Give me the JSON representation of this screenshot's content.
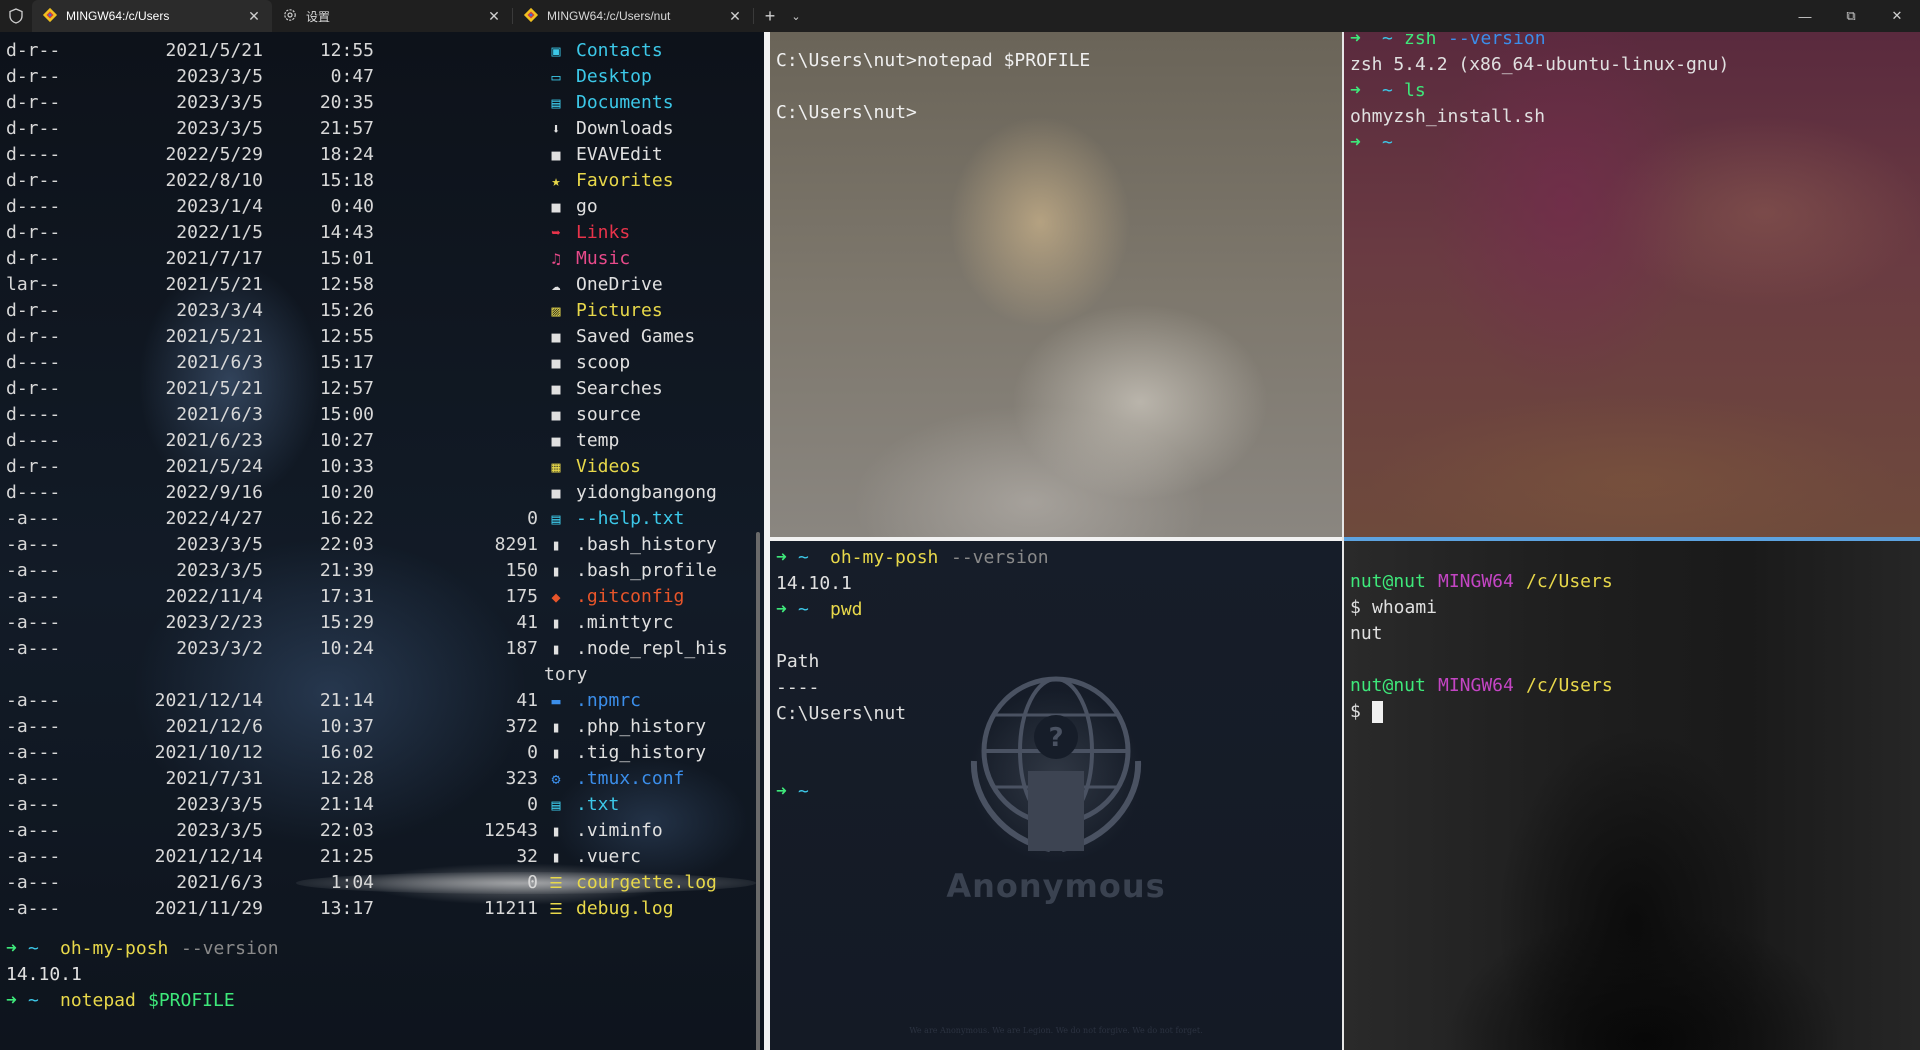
{
  "tabs": [
    {
      "title": "MINGW64:/c/Users",
      "active": true,
      "icon": "git-diamond-icon"
    },
    {
      "title": "设置",
      "active": false,
      "icon": "gear-icon"
    },
    {
      "title": "MINGW64:/c/Users/nut",
      "active": false,
      "icon": "git-diamond-icon"
    }
  ],
  "titlebar": {
    "new_tab": "+",
    "dropdown": "⌄",
    "minimize": "—",
    "maximize": "⧉",
    "close": "✕",
    "tab_close": "✕"
  },
  "colors": {
    "folder": "#e0e0e0",
    "accent_cyan": "#3cc8e8",
    "accent_yellow": "#e8d84a",
    "accent_red": "#e8334a",
    "accent_pink": "#e84a8a",
    "prompt_green": "#3ee87a"
  },
  "listing": [
    {
      "mode": "d-r--",
      "date": "2021/5/21",
      "time": "12:55",
      "size": "",
      "name": "Contacts",
      "icon": "contacts-icon",
      "color": "#3cc8e8"
    },
    {
      "mode": "d-r--",
      "date": "2023/3/5",
      "time": "0:47",
      "size": "",
      "name": "Desktop",
      "icon": "desktop-icon",
      "color": "#3cc8e8"
    },
    {
      "mode": "d-r--",
      "date": "2023/3/5",
      "time": "20:35",
      "size": "",
      "name": "Documents",
      "icon": "documents-icon",
      "color": "#3cc8e8"
    },
    {
      "mode": "d-r--",
      "date": "2023/3/5",
      "time": "21:57",
      "size": "",
      "name": "Downloads",
      "icon": "download-icon",
      "color": "#e0e0e0"
    },
    {
      "mode": "d----",
      "date": "2022/5/29",
      "time": "18:24",
      "size": "",
      "name": "EVAVEdit",
      "icon": "folder-icon",
      "color": "#e0e0e0"
    },
    {
      "mode": "d-r--",
      "date": "2022/8/10",
      "time": "15:18",
      "size": "",
      "name": "Favorites",
      "icon": "favorites-folder-icon",
      "color": "#e8d84a"
    },
    {
      "mode": "d----",
      "date": "2023/1/4",
      "time": "0:40",
      "size": "",
      "name": "go",
      "icon": "folder-icon",
      "color": "#e0e0e0"
    },
    {
      "mode": "d-r--",
      "date": "2022/1/5",
      "time": "14:43",
      "size": "",
      "name": "Links",
      "icon": "links-icon",
      "color": "#e8334a"
    },
    {
      "mode": "d-r--",
      "date": "2021/7/17",
      "time": "15:01",
      "size": "",
      "name": "Music",
      "icon": "music-icon",
      "color": "#e84a8a"
    },
    {
      "mode": "lar--",
      "date": "2021/5/21",
      "time": "12:58",
      "size": "",
      "name": "OneDrive",
      "icon": "cloud-icon",
      "color": "#e0e0e0"
    },
    {
      "mode": "d-r--",
      "date": "2023/3/4",
      "time": "15:26",
      "size": "",
      "name": "Pictures",
      "icon": "pictures-icon",
      "color": "#e8d84a"
    },
    {
      "mode": "d-r--",
      "date": "2021/5/21",
      "time": "12:55",
      "size": "",
      "name": "Saved Games",
      "icon": "folder-icon",
      "color": "#e0e0e0"
    },
    {
      "mode": "d----",
      "date": "2021/6/3",
      "time": "15:17",
      "size": "",
      "name": "scoop",
      "icon": "folder-icon",
      "color": "#e0e0e0"
    },
    {
      "mode": "d-r--",
      "date": "2021/5/21",
      "time": "12:57",
      "size": "",
      "name": "Searches",
      "icon": "folder-icon",
      "color": "#e0e0e0"
    },
    {
      "mode": "d----",
      "date": "2021/6/3",
      "time": "15:00",
      "size": "",
      "name": "source",
      "icon": "folder-icon",
      "color": "#e0e0e0"
    },
    {
      "mode": "d----",
      "date": "2021/6/23",
      "time": "10:27",
      "size": "",
      "name": "temp",
      "icon": "folder-icon",
      "color": "#e0e0e0"
    },
    {
      "mode": "d-r--",
      "date": "2021/5/24",
      "time": "10:33",
      "size": "",
      "name": "Videos",
      "icon": "videos-icon",
      "color": "#e8d84a"
    },
    {
      "mode": "d----",
      "date": "2022/9/16",
      "time": "10:20",
      "size": "",
      "name": "yidongbangong",
      "icon": "folder-icon",
      "color": "#e0e0e0"
    },
    {
      "mode": "-a---",
      "date": "2022/4/27",
      "time": "16:22",
      "size": "0",
      "name": "--help.txt",
      "icon": "text-file-icon",
      "color": "#3cc8e8"
    },
    {
      "mode": "-a---",
      "date": "2023/3/5",
      "time": "22:03",
      "size": "8291",
      "name": ".bash_history",
      "icon": "file-icon",
      "color": "#e0e0e0"
    },
    {
      "mode": "-a---",
      "date": "2023/3/5",
      "time": "21:39",
      "size": "150",
      "name": ".bash_profile",
      "icon": "file-icon",
      "color": "#e0e0e0"
    },
    {
      "mode": "-a---",
      "date": "2022/11/4",
      "time": "17:31",
      "size": "175",
      "name": ".gitconfig",
      "icon": "git-icon",
      "color": "#e8552a"
    },
    {
      "mode": "-a---",
      "date": "2023/2/23",
      "time": "15:29",
      "size": "41",
      "name": ".minttyrc",
      "icon": "file-icon",
      "color": "#e0e0e0"
    },
    {
      "mode": "-a---",
      "date": "2023/3/2",
      "time": "10:24",
      "size": "187",
      "name": ".node_repl_his",
      "icon": "file-icon",
      "color": "#e0e0e0",
      "wrap": "tory"
    },
    {
      "mode": "-a---",
      "date": "2021/12/14",
      "time": "21:14",
      "size": "41",
      "name": ".npmrc",
      "icon": "npm-icon",
      "color": "#3b8eea"
    },
    {
      "mode": "-a---",
      "date": "2021/12/6",
      "time": "10:37",
      "size": "372",
      "name": ".php_history",
      "icon": "file-icon",
      "color": "#e0e0e0"
    },
    {
      "mode": "-a---",
      "date": "2021/10/12",
      "time": "16:02",
      "size": "0",
      "name": ".tig_history",
      "icon": "file-icon",
      "color": "#e0e0e0"
    },
    {
      "mode": "-a---",
      "date": "2021/7/31",
      "time": "12:28",
      "size": "323",
      "name": ".tmux.conf",
      "icon": "settings-icon",
      "color": "#3b8eea"
    },
    {
      "mode": "-a---",
      "date": "2023/3/5",
      "time": "21:14",
      "size": "0",
      "name": ".txt",
      "icon": "text-file-icon",
      "color": "#3cc8e8"
    },
    {
      "mode": "-a---",
      "date": "2023/3/5",
      "time": "22:03",
      "size": "12543",
      "name": ".viminfo",
      "icon": "file-icon",
      "color": "#e0e0e0"
    },
    {
      "mode": "-a---",
      "date": "2021/12/14",
      "time": "21:25",
      "size": "32",
      "name": ".vuerc",
      "icon": "file-icon",
      "color": "#e0e0e0"
    },
    {
      "mode": "-a---",
      "date": "2021/6/3",
      "time": "1:04",
      "size": "0",
      "name": "courgette.log",
      "icon": "log-icon",
      "color": "#e8d84a",
      "highlight": true
    },
    {
      "mode": "-a---",
      "date": "2021/11/29",
      "time": "13:17",
      "size": "11211",
      "name": "debug.log",
      "icon": "log-icon",
      "color": "#e8d84a"
    }
  ],
  "left_bottom": {
    "arrow": "➜",
    "home": "~",
    "cmd1": "oh-my-posh",
    "arg1": "--version",
    "out1": "14.10.1",
    "cmd2": "notepad",
    "arg2": "$PROFILE"
  },
  "pane_tl": {
    "line1": "C:\\Users\\nut>notepad $PROFILE",
    "line2": "C:\\Users\\nut>"
  },
  "pane_tr": {
    "arrow": "➜",
    "home": "~",
    "cmd1": "zsh",
    "arg1": "--version",
    "out1": "zsh 5.4.2 (x86_64-ubuntu-linux-gnu)",
    "cmd2": "ls",
    "out2": "ohmyzsh_install.sh"
  },
  "pane_bl": {
    "arrow": "➜",
    "home": "~",
    "cmd1": "oh-my-posh",
    "arg1": "--version",
    "out1": "14.10.1",
    "cmd2": "pwd",
    "header": "Path",
    "rule": "----",
    "path": "C:\\Users\\nut",
    "logo_text": "Anonymous",
    "motto": "We are Anonymous. We are Legion. We do not forgive. We do not forget."
  },
  "pane_br": {
    "user": "nut@nut",
    "env": "MINGW64",
    "dir": "/c/Users",
    "prompt": "$",
    "cmd": "whoami",
    "out": "nut"
  }
}
